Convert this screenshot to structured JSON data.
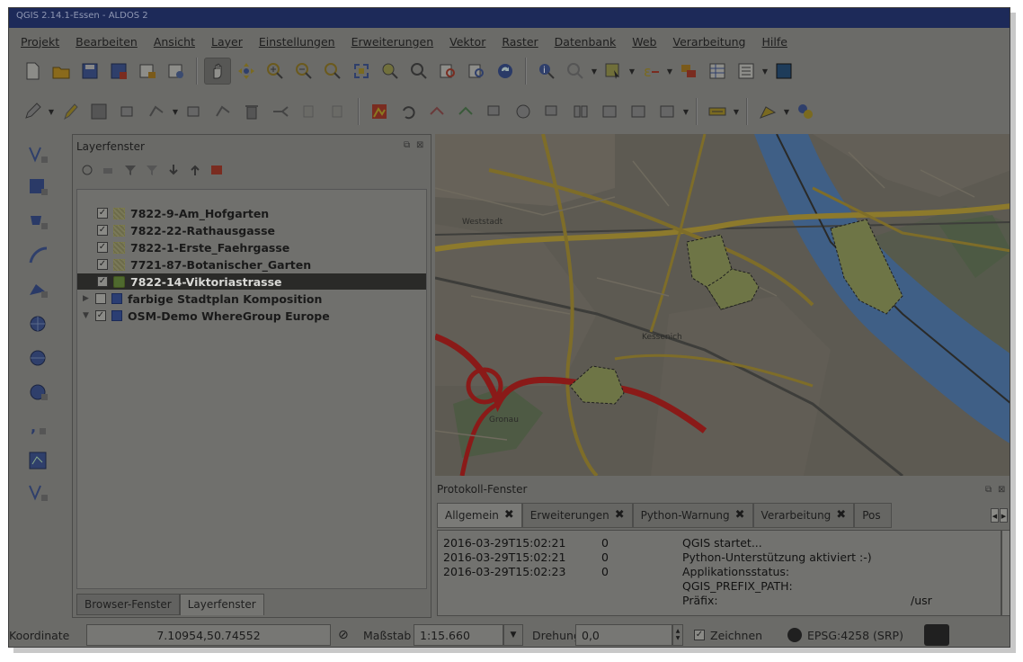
{
  "window": {
    "title": "QGIS 2.14.1-Essen - ALDOS 2"
  },
  "menubar": {
    "items": [
      "Projekt",
      "Bearbeiten",
      "Ansicht",
      "Layer",
      "Einstellungen",
      "Erweiterungen",
      "Vektor",
      "Raster",
      "Datenbank",
      "Web",
      "Verarbeitung",
      "Hilfe"
    ]
  },
  "layers_panel": {
    "title": "Layerfenster",
    "layers": [
      {
        "name": "7822-9-Am_Hofgarten",
        "checked": true,
        "type": "polygon",
        "selected": false
      },
      {
        "name": "7822-22-Rathausgasse",
        "checked": true,
        "type": "polygon",
        "selected": false
      },
      {
        "name": "7822-1-Erste_Faehrgasse",
        "checked": true,
        "type": "polygon",
        "selected": false
      },
      {
        "name": "7721-87-Botanischer_Garten",
        "checked": true,
        "type": "polygon",
        "selected": false
      },
      {
        "name": "7822-14-Viktoriastrasse",
        "checked": true,
        "type": "polygon",
        "selected": true
      },
      {
        "name": "farbige Stadtplan Komposition",
        "checked": false,
        "type": "group",
        "expanded": false
      },
      {
        "name": "OSM-Demo WhereGroup Europe",
        "checked": true,
        "type": "group",
        "expanded": true
      }
    ],
    "tabs": [
      "Browser-Fenster",
      "Layerfenster"
    ],
    "active_tab": "Layerfenster"
  },
  "log_panel": {
    "title": "Protokoll-Fenster",
    "tabs": [
      "Allgemein",
      "Erweiterungen",
      "Python-Warnung",
      "Verarbeitung",
      "Pos"
    ],
    "active_tab": "Allgemein",
    "entries": [
      {
        "timestamp": "2016-03-29T15:02:21",
        "level": "0",
        "message": "QGIS startet..."
      },
      {
        "timestamp": "2016-03-29T15:02:21",
        "level": "0",
        "message": "Python-Unterstützung aktiviert :-)"
      },
      {
        "timestamp": "2016-03-29T15:02:23",
        "level": "0",
        "message": "Applikationsstatus:"
      },
      {
        "timestamp": "",
        "level": "",
        "message": "QGIS_PREFIX_PATH:"
      },
      {
        "timestamp": "",
        "level": "",
        "message": "Präfix:",
        "value": "/usr"
      }
    ]
  },
  "statusbar": {
    "coord_label": "Koordinate",
    "coord_value": "7.10954,50.74552",
    "scale_label": "Maßstab",
    "scale_value": "1:15.660",
    "rotation_label": "Drehung",
    "rotation_value": "0,0",
    "render_label": "Zeichnen",
    "render_checked": true,
    "crs_label": "EPSG:4258 (SRP)"
  },
  "map": {
    "labels": [
      "Weststadt",
      "Kessenich",
      "Gronau"
    ],
    "colors": {
      "river": "#3f5f86",
      "motorway": "#8a1a18",
      "road": "#8d7a2c",
      "parcel": "#6e7546"
    }
  },
  "icons": {
    "toolbar1": [
      "new-project-icon",
      "open-project-icon",
      "save-project-icon",
      "save-as-icon",
      "print-composer-icon",
      "composer-manager-icon",
      "pan-icon",
      "pan-to-selection-icon",
      "zoom-in-icon",
      "zoom-out-icon",
      "zoom-native-icon",
      "zoom-full-icon",
      "zoom-selection-icon",
      "zoom-layer-icon",
      "zoom-last-icon",
      "zoom-next-icon",
      "refresh-icon",
      "identify-icon",
      "measure-icon",
      "select-icon",
      "deselect-icon",
      "attribute-table-icon",
      "field-calc-icon",
      "help-icon"
    ],
    "toolbar2": [
      "edit-pencil-icon",
      "toggle-edit-icon",
      "save-edits-icon",
      "add-feature-icon",
      "node-tool-icon",
      "move-feature-icon",
      "delete-icon",
      "cut-icon",
      "copy-icon",
      "paste-icon",
      "digitize-icon",
      "undo-icon",
      "redo-icon",
      "rotate-icon",
      "simplify-icon",
      "add-ring-icon",
      "fill-ring-icon",
      "add-part-icon",
      "split-icon",
      "merge-icon",
      "label-icon",
      "style-icon",
      "python-icon"
    ],
    "leftbar": [
      "add-vector-icon",
      "add-raster-icon",
      "add-postgis-icon",
      "add-spatialite-icon",
      "add-wms-icon",
      "add-wfs-icon",
      "add-wcs-icon",
      "add-wms-tile-icon",
      "add-delimited-text-icon",
      "add-virtual-layer-icon",
      "new-shapefile-icon"
    ]
  }
}
